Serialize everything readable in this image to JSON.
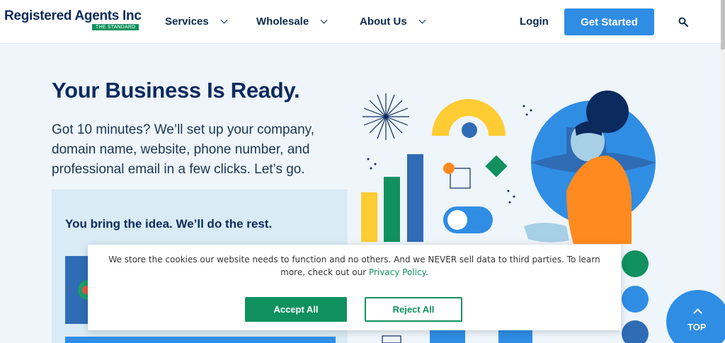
{
  "header": {
    "logo_text": "Registered Agents Inc",
    "logo_badge": "THE STANDARD",
    "nav": [
      {
        "label": "Services"
      },
      {
        "label": "Wholesale"
      },
      {
        "label": "About Us"
      }
    ],
    "login_label": "Login",
    "cta_label": "Get Started"
  },
  "hero": {
    "title": "Your Business Is Ready.",
    "text": "Got 10 minutes? We’ll set up your company, domain name, website, phone number, and professional email in a few clicks. Let’s go.",
    "promo_title": "You bring the idea. We’ll do the rest."
  },
  "cookie": {
    "text": "We store the cookies our website needs to function and no others. And we NEVER sell data to third parties. To learn more, check out our ",
    "link": "Privacy Policy",
    "after_link": ".",
    "accept_label": "Accept All",
    "reject_label": "Reject All"
  },
  "top_button": {
    "label": "TOP"
  },
  "colors": {
    "brand_blue": "#0b2a5e",
    "accent_blue": "#2f8de4",
    "brand_green": "#10915f",
    "yellow": "#ffcc33",
    "orange": "#ff8a1f"
  }
}
